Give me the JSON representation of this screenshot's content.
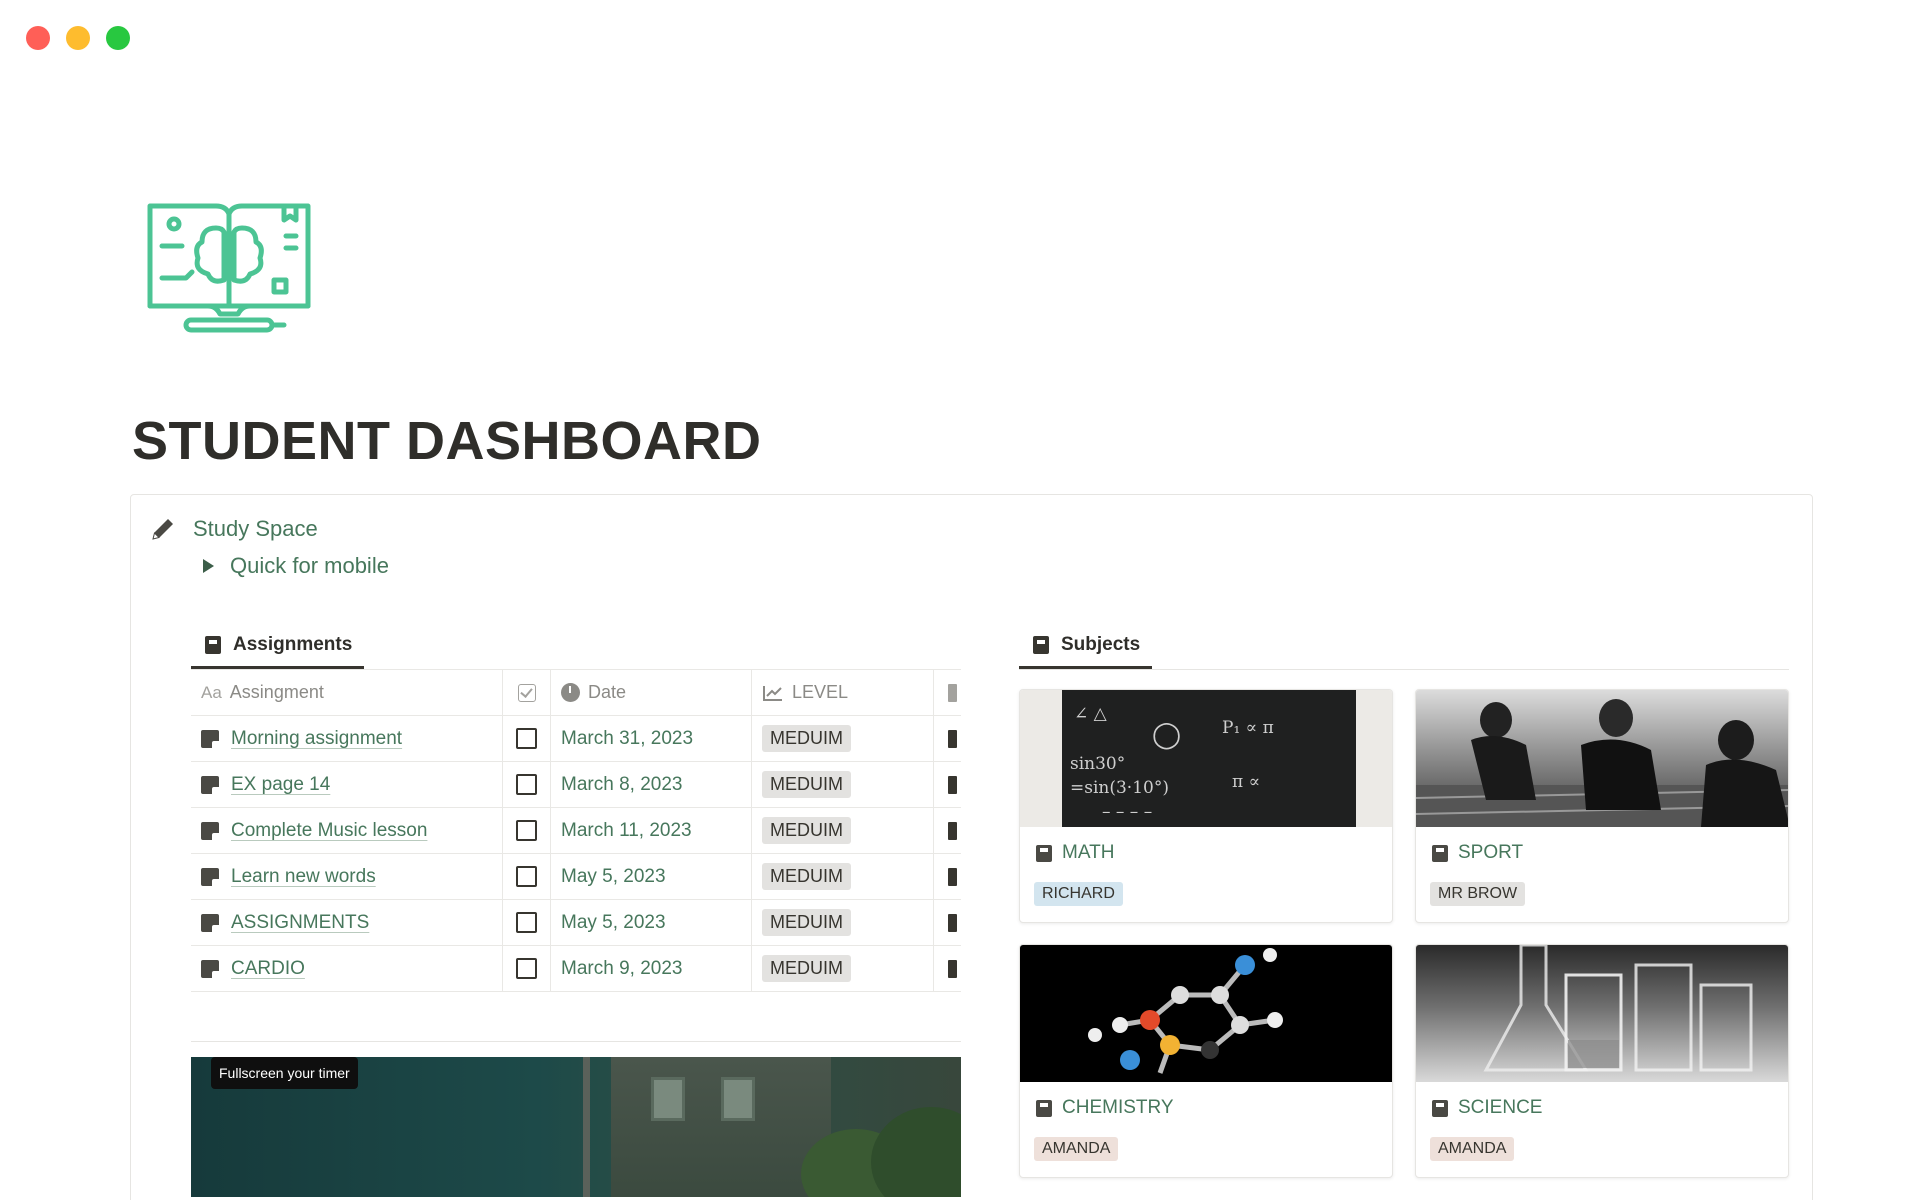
{
  "page": {
    "title": "STUDENT DASHBOARD",
    "icon": "book-brain-icon",
    "accent_color": "#47775c"
  },
  "callout": {
    "icon": "pencil-icon",
    "label": "Study Space",
    "toggle_label": "Quick for mobile"
  },
  "assignments": {
    "tab_label": "Assignments",
    "columns": {
      "name": "Assingment",
      "name_prefix": "Aa",
      "date": "Date",
      "level": "LEVEL"
    },
    "rows": [
      {
        "name": "Morning assignment",
        "done": false,
        "date": "March 31, 2023",
        "level": "MEDUIM"
      },
      {
        "name": "EX page 14",
        "done": false,
        "date": "March 8, 2023",
        "level": "MEDUIM"
      },
      {
        "name": "Complete Music lesson",
        "done": false,
        "date": "March 11, 2023",
        "level": "MEDUIM"
      },
      {
        "name": "Learn new words",
        "done": false,
        "date": "May 5, 2023",
        "level": "MEDUIM"
      },
      {
        "name": "ASSIGNMENTS",
        "done": false,
        "date": "May 5, 2023",
        "level": "MEDUIM"
      },
      {
        "name": "CARDIO",
        "done": false,
        "date": "March 9, 2023",
        "level": "MEDUIM"
      }
    ]
  },
  "timer": {
    "tooltip": "Fullscreen your timer"
  },
  "subjects": {
    "tab_label": "Subjects",
    "cards": [
      {
        "title": "MATH",
        "tag": "RICHARD",
        "tag_color": "blue"
      },
      {
        "title": "SPORT",
        "tag": "MR BROW",
        "tag_color": "gray"
      },
      {
        "title": "CHEMISTRY",
        "tag": "AMANDA",
        "tag_color": "brown"
      },
      {
        "title": "SCIENCE",
        "tag": "AMANDA",
        "tag_color": "brown"
      }
    ]
  }
}
